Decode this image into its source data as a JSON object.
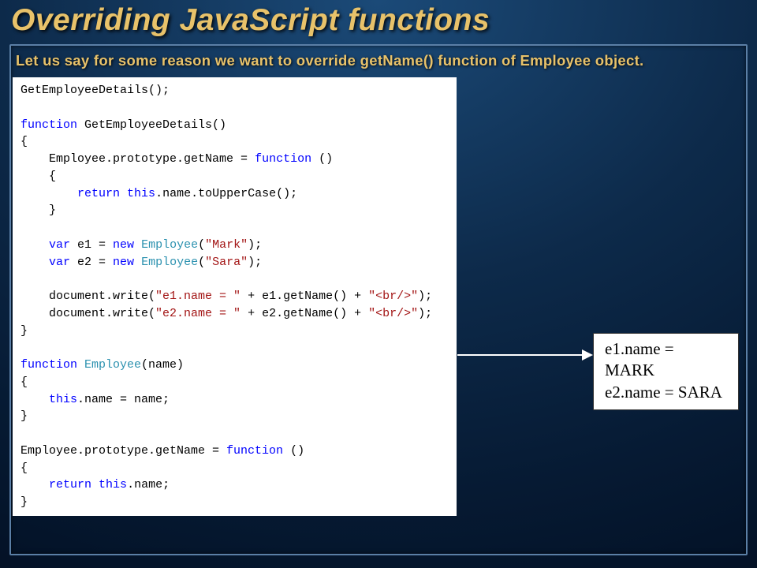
{
  "title": "Overriding JavaScript functions",
  "subtitle": "Let us say for some reason we want to override getName() function of Employee object.",
  "code": {
    "l01": "GetEmployeeDetails();",
    "l03a": "function",
    "l03b": " GetEmployeeDetails()",
    "l04": "{",
    "l05a": "    Employee.prototype.getName = ",
    "l05b": "function",
    "l05c": " ()",
    "l06": "    {",
    "l07a": "        ",
    "l07b": "return",
    "l07c": " ",
    "l07d": "this",
    "l07e": ".name.toUpperCase();",
    "l08": "    }",
    "l10a": "    ",
    "l10b": "var",
    "l10c": " e1 = ",
    "l10d": "new",
    "l10e": " ",
    "l10f": "Employee",
    "l10g": "(",
    "l10h": "\"Mark\"",
    "l10i": ");",
    "l11a": "    ",
    "l11b": "var",
    "l11c": " e2 = ",
    "l11d": "new",
    "l11e": " ",
    "l11f": "Employee",
    "l11g": "(",
    "l11h": "\"Sara\"",
    "l11i": ");",
    "l13a": "    document.write(",
    "l13b": "\"e1.name = \"",
    "l13c": " + e1.getName() + ",
    "l13d": "\"<br/>\"",
    "l13e": ");",
    "l14a": "    document.write(",
    "l14b": "\"e2.name = \"",
    "l14c": " + e2.getName() + ",
    "l14d": "\"<br/>\"",
    "l14e": ");",
    "l15": "}",
    "l17a": "function",
    "l17b": " ",
    "l17c": "Employee",
    "l17d": "(name)",
    "l18": "{",
    "l19a": "    ",
    "l19b": "this",
    "l19c": ".name = name;",
    "l20": "}",
    "l22a": "Employee.prototype.getName = ",
    "l22b": "function",
    "l22c": " ()",
    "l23": "{",
    "l24a": "    ",
    "l24b": "return",
    "l24c": " ",
    "l24d": "this",
    "l24e": ".name;",
    "l25": "}"
  },
  "output": {
    "line1": "e1.name = MARK",
    "line2": "e2.name = SARA"
  }
}
